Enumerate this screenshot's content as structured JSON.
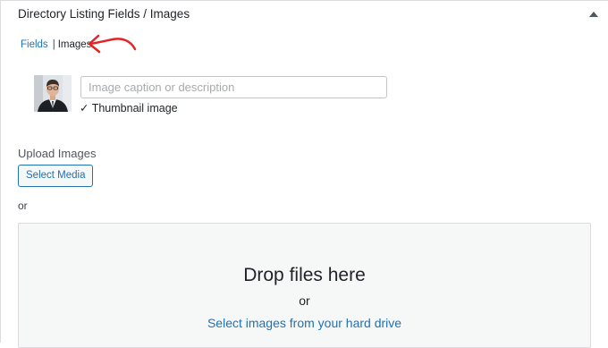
{
  "panel": {
    "title": "Directory Listing Fields / Images"
  },
  "tabs": {
    "fields_label": "Fields",
    "separator": "|",
    "images_label": "Images",
    "active": "Images"
  },
  "images": [
    {
      "caption_placeholder": "Image caption or description",
      "caption_value": "",
      "thumbnail_label": "✓ Thumbnail image"
    }
  ],
  "upload": {
    "heading": "Upload Images",
    "select_media_label": "Select Media",
    "or_label": "or",
    "dropzone": {
      "title": "Drop files here",
      "or_label": "or",
      "link_label": "Select images from your hard drive"
    }
  },
  "icons": {
    "collapse": "caret-up-icon",
    "annotation": "red-arrow-icon"
  },
  "colors": {
    "link": "#2271b1",
    "annotation": "#e32424",
    "dropzone_bg": "#f6f7f7",
    "border": "#dcdcde"
  }
}
